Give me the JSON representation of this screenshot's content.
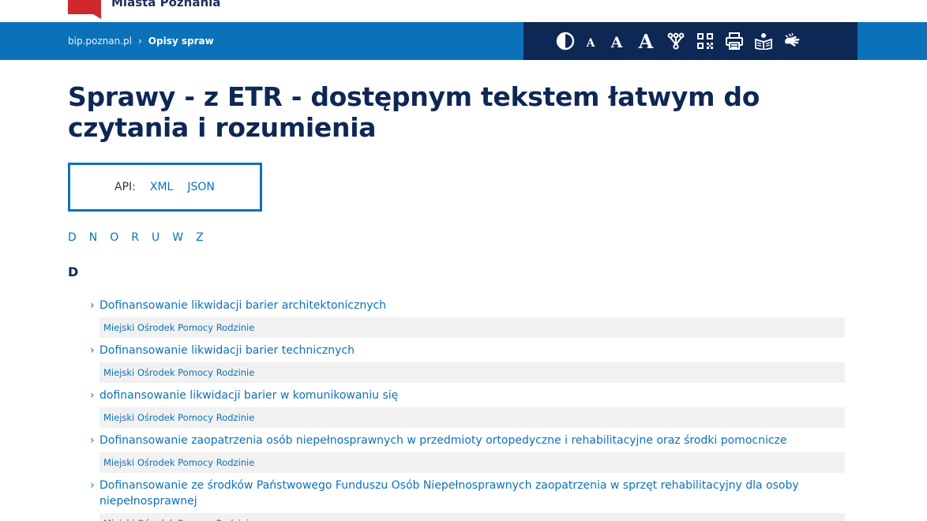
{
  "header": {
    "logo_text": "Miasta Poznania"
  },
  "breadcrumb": {
    "home": "bip.poznan.pl",
    "separator": "›",
    "current": "Opisy spraw"
  },
  "accessibility": {
    "font_small": "A",
    "font_medium": "A",
    "font_large": "A"
  },
  "page": {
    "title": "Sprawy - z ETR - dostępnym tekstem łatwym do czytania i rozumienia"
  },
  "api": {
    "label": "API:",
    "xml": "XML",
    "json": "JSON"
  },
  "letters": [
    "D",
    "N",
    "O",
    "R",
    "U",
    "W",
    "Z"
  ],
  "section": {
    "letter": "D",
    "items": [
      {
        "title": "Dofinansowanie likwidacji barier architektonicznych",
        "unit": "Miejski Ośrodek Pomocy Rodzinie"
      },
      {
        "title": "Dofinansowanie likwidacji barier technicznych",
        "unit": "Miejski Ośrodek Pomocy Rodzinie"
      },
      {
        "title": "dofinansowanie likwidacji barier w komunikowaniu się",
        "unit": "Miejski Ośrodek Pomocy Rodzinie"
      },
      {
        "title": "Dofinansowanie zaopatrzenia osób niepełnosprawnych w przedmioty ortopedyczne i rehabilitacyjne oraz środki pomocnicze",
        "unit": "Miejski Ośrodek Pomocy Rodzinie"
      },
      {
        "title": "Dofinansowanie ze środków Państwowego Funduszu Osób Niepełnosprawnych zaopatrzenia w sprzęt rehabilitacyjny dla osoby niepełnosprawnej",
        "unit": "Miejski Ośrodek Pomocy Rodzinie"
      }
    ]
  },
  "colors": {
    "navbar": "#0b72b9",
    "a11y_bar": "#0e2855",
    "title": "#0e2855",
    "link": "#0b72b9",
    "logo_red": "#d0272c"
  }
}
